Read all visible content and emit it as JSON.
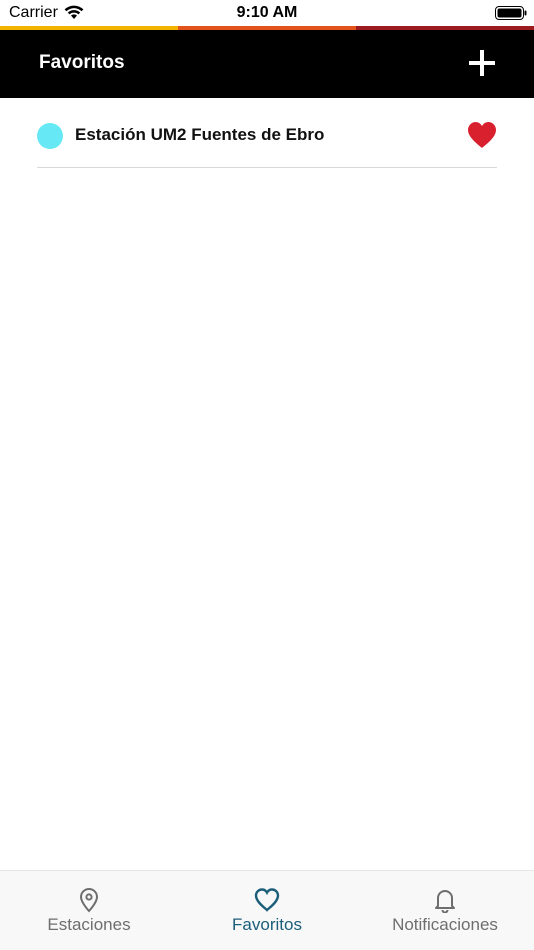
{
  "status_bar": {
    "carrier": "Carrier",
    "time": "9:10 AM"
  },
  "colors": {
    "strip": [
      "#f2b400",
      "#e3541c",
      "#9b1b1e"
    ],
    "header_bg": "#000000",
    "status_dot": "#67e8f5",
    "heart": "#d8202e",
    "tab_active": "#1b5e7a",
    "tab_inactive": "#6e6e6e"
  },
  "header": {
    "title": "Favoritos",
    "add_icon": "plus-icon"
  },
  "favorites": [
    {
      "label": "Estación UM2 Fuentes de Ebro",
      "icon": "heart-icon"
    }
  ],
  "tabs": [
    {
      "label": "Estaciones",
      "icon": "location-pin-icon",
      "active": false
    },
    {
      "label": "Favoritos",
      "icon": "heart-outline-icon",
      "active": true
    },
    {
      "label": "Notificaciones",
      "icon": "bell-icon",
      "active": false
    }
  ]
}
